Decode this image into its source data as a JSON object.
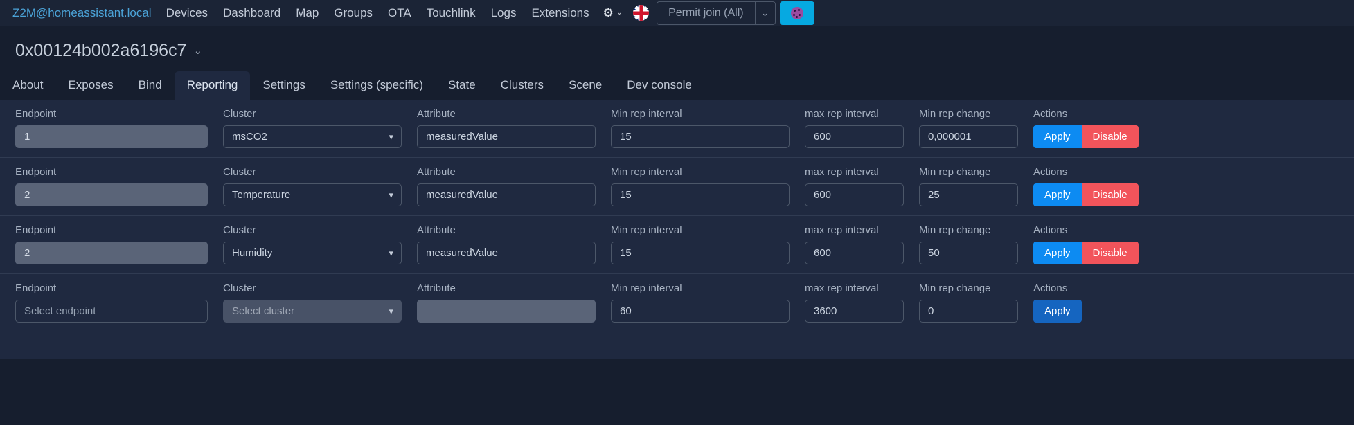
{
  "navbar": {
    "brand": "Z2M@homeassistant.local",
    "links": [
      "Devices",
      "Dashboard",
      "Map",
      "Groups",
      "OTA",
      "Touchlink",
      "Logs",
      "Extensions"
    ],
    "settings_icon": "gear-icon",
    "settings_caret": "⌄",
    "language_icon": "uk-flag-icon",
    "permit_join_label": "Permit join (All)",
    "permit_join_caret": "⌄",
    "zigbee_button_icon": "zigbee-network-icon",
    "accent_blue": "#06a9e1"
  },
  "device": {
    "title": "0x00124b002a6196c7",
    "caret": "⌄"
  },
  "tabs": [
    {
      "label": "About",
      "active": false
    },
    {
      "label": "Exposes",
      "active": false
    },
    {
      "label": "Bind",
      "active": false
    },
    {
      "label": "Reporting",
      "active": true
    },
    {
      "label": "Settings",
      "active": false
    },
    {
      "label": "Settings (specific)",
      "active": false
    },
    {
      "label": "State",
      "active": false
    },
    {
      "label": "Clusters",
      "active": false
    },
    {
      "label": "Scene",
      "active": false
    },
    {
      "label": "Dev console",
      "active": false
    }
  ],
  "columns": {
    "endpoint": "Endpoint",
    "cluster": "Cluster",
    "attribute": "Attribute",
    "min_rep_interval": "Min rep interval",
    "max_rep_interval": "max rep interval",
    "min_rep_change": "Min rep change",
    "actions": "Actions"
  },
  "buttons": {
    "apply": "Apply",
    "disable": "Disable",
    "apply_color": "#0d8bf2",
    "disable_color": "#f2545b",
    "apply_muted_color": "#1565c0"
  },
  "placeholders": {
    "endpoint": "Select endpoint",
    "cluster": "Select cluster",
    "attribute": ""
  },
  "rows": [
    {
      "endpoint": "1",
      "endpoint_disabled": true,
      "cluster": "msCO2",
      "cluster_disabled": false,
      "attribute": "measuredValue",
      "attribute_disabled": false,
      "min_rep_interval": "15",
      "max_rep_interval": "600",
      "min_rep_change": "0,000001",
      "has_disable": true
    },
    {
      "endpoint": "2",
      "endpoint_disabled": true,
      "cluster": "Temperature",
      "cluster_disabled": false,
      "attribute": "measuredValue",
      "attribute_disabled": false,
      "min_rep_interval": "15",
      "max_rep_interval": "600",
      "min_rep_change": "25",
      "has_disable": true
    },
    {
      "endpoint": "2",
      "endpoint_disabled": true,
      "cluster": "Humidity",
      "cluster_disabled": false,
      "attribute": "measuredValue",
      "attribute_disabled": false,
      "min_rep_interval": "15",
      "max_rep_interval": "600",
      "min_rep_change": "50",
      "has_disable": true
    },
    {
      "endpoint": "",
      "endpoint_disabled": false,
      "cluster": "",
      "cluster_disabled": true,
      "attribute": "",
      "attribute_disabled": true,
      "min_rep_interval": "60",
      "max_rep_interval": "3600",
      "min_rep_change": "0",
      "has_disable": false
    }
  ]
}
